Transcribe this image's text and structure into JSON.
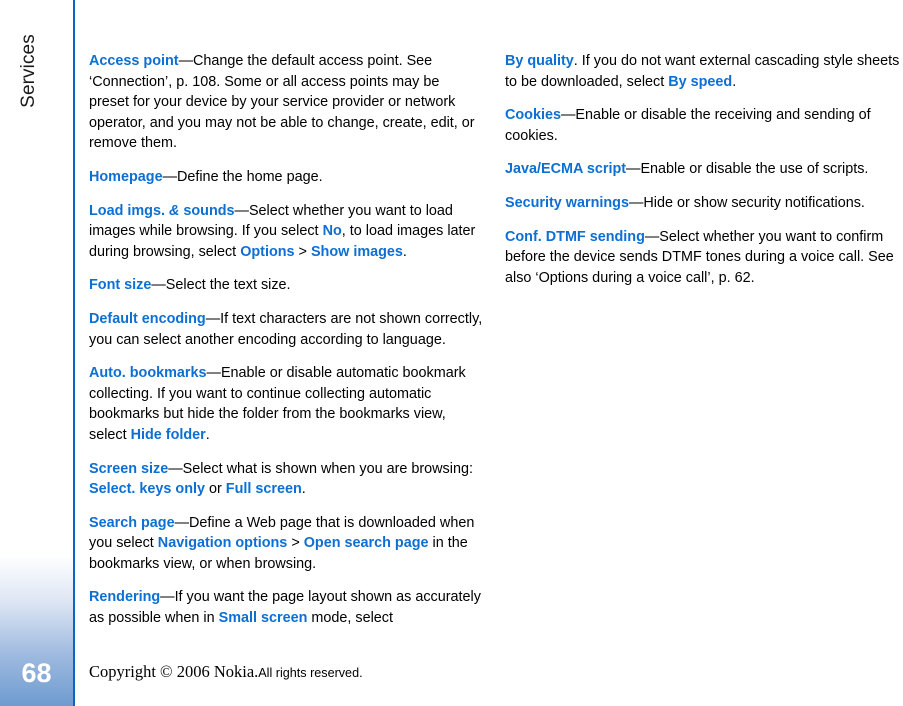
{
  "sidebar": {
    "chapter_title": "Services",
    "page_number": "68",
    "rule_color": "#0a66c2",
    "gradient_bottom_color": "#6e9bd0"
  },
  "theme": {
    "keyword_color": "#0d6fd4",
    "body_text_color": "#000000",
    "background_color": "#ffffff"
  },
  "footer": {
    "copyright_main": "Copyright © 2006 Nokia.",
    "copyright_rights": "All rights reserved."
  },
  "content": {
    "left_column": [
      {
        "id": "access-point",
        "runs": [
          {
            "type": "kw",
            "text": "Access point"
          },
          {
            "type": "text",
            "text": "—Change the default access point. See ‘Connection’, p. 108. Some or all access points may be preset for your device by your service provider or network operator, and you may not be able to change, create, edit, or remove them."
          }
        ]
      },
      {
        "id": "homepage",
        "runs": [
          {
            "type": "kw",
            "text": "Homepage"
          },
          {
            "type": "text",
            "text": "—Define the home page."
          }
        ]
      },
      {
        "id": "load-imgs-sounds",
        "runs": [
          {
            "type": "kw",
            "text": "Load imgs. "
          },
          {
            "type": "amp",
            "text": "&"
          },
          {
            "type": "kw",
            "text": " sounds"
          },
          {
            "type": "text",
            "text": "—Select whether you want to load images while browsing. If you select "
          },
          {
            "type": "kw",
            "text": "No"
          },
          {
            "type": "text",
            "text": ", to load images later during browsing, select "
          },
          {
            "type": "kw",
            "text": "Options"
          },
          {
            "type": "text",
            "text": " > "
          },
          {
            "type": "kw",
            "text": "Show images"
          },
          {
            "type": "text",
            "text": "."
          }
        ]
      },
      {
        "id": "font-size",
        "runs": [
          {
            "type": "kw",
            "text": "Font size"
          },
          {
            "type": "text",
            "text": "—Select the text size."
          }
        ]
      },
      {
        "id": "default-encoding",
        "runs": [
          {
            "type": "kw",
            "text": "Default encoding"
          },
          {
            "type": "text",
            "text": "—If text characters are not shown correctly, you can select another encoding according to language."
          }
        ]
      },
      {
        "id": "auto-bookmarks",
        "runs": [
          {
            "type": "kw",
            "text": "Auto. bookmarks"
          },
          {
            "type": "text",
            "text": "—Enable or disable automatic bookmark collecting. If you want to continue collecting automatic bookmarks but hide the folder from the bookmarks view, select "
          },
          {
            "type": "kw",
            "text": "Hide folder"
          },
          {
            "type": "text",
            "text": "."
          }
        ]
      },
      {
        "id": "screen-size",
        "runs": [
          {
            "type": "kw",
            "text": "Screen size"
          },
          {
            "type": "text",
            "text": "—Select what is shown when you are browsing: "
          },
          {
            "type": "kw",
            "text": "Select. keys only"
          },
          {
            "type": "text",
            "text": " or "
          },
          {
            "type": "kw",
            "text": "Full screen"
          },
          {
            "type": "text",
            "text": "."
          }
        ]
      },
      {
        "id": "search-page",
        "runs": [
          {
            "type": "kw",
            "text": "Search page"
          },
          {
            "type": "text",
            "text": "—Define a Web page that is downloaded when you select "
          },
          {
            "type": "kw",
            "text": "Navigation options"
          },
          {
            "type": "text",
            "text": " > "
          },
          {
            "type": "kw",
            "text": "Open search page"
          },
          {
            "type": "text",
            "text": " in the bookmarks view, or when browsing."
          }
        ]
      },
      {
        "id": "rendering",
        "runs": [
          {
            "type": "kw",
            "text": "Rendering"
          },
          {
            "type": "text",
            "text": "—If you want the page layout shown as accurately as possible when in "
          },
          {
            "type": "kw",
            "text": "Small screen"
          },
          {
            "type": "text",
            "text": " mode, select"
          }
        ]
      }
    ],
    "right_column": [
      {
        "id": "by-quality",
        "runs": [
          {
            "type": "kw",
            "text": "By quality"
          },
          {
            "type": "text",
            "text": ". If you do not want external cascading style sheets to be downloaded, select "
          },
          {
            "type": "kw",
            "text": "By speed"
          },
          {
            "type": "text",
            "text": "."
          }
        ]
      },
      {
        "id": "cookies",
        "runs": [
          {
            "type": "kw",
            "text": "Cookies"
          },
          {
            "type": "text",
            "text": "—Enable or disable the receiving and sending of cookies."
          }
        ]
      },
      {
        "id": "java-ecma-script",
        "runs": [
          {
            "type": "kw",
            "text": "Java/ECMA script"
          },
          {
            "type": "text",
            "text": "—Enable or disable the use of scripts."
          }
        ]
      },
      {
        "id": "security-warnings",
        "runs": [
          {
            "type": "kw",
            "text": "Security warnings"
          },
          {
            "type": "text",
            "text": "—Hide or show security notifications."
          }
        ]
      },
      {
        "id": "conf-dtmf-sending",
        "runs": [
          {
            "type": "kw",
            "text": "Conf. DTMF sending"
          },
          {
            "type": "text",
            "text": "—Select whether you want to confirm before the device sends DTMF tones during a voice call. See also ‘Options during a voice call’, p. 62."
          }
        ]
      }
    ]
  }
}
